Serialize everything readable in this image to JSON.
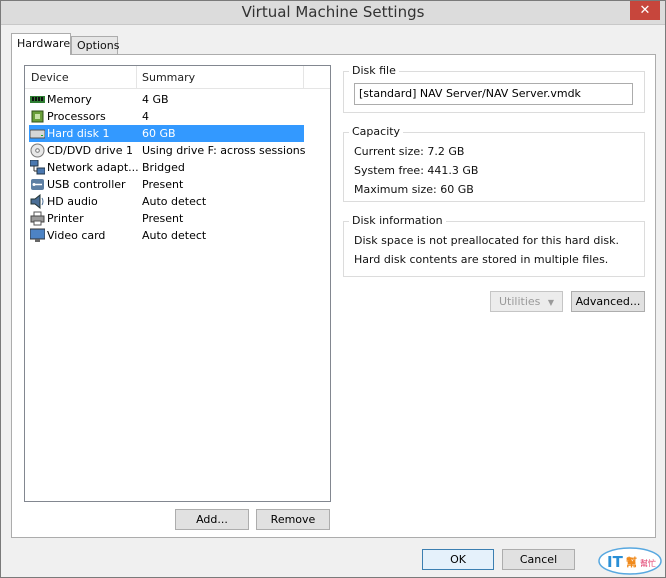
{
  "window": {
    "title": "Virtual Machine Settings",
    "close_glyph": "✕"
  },
  "tabs": [
    {
      "label": "Hardware",
      "active": true
    },
    {
      "label": "Options",
      "active": false
    }
  ],
  "device_list": {
    "columns": [
      "Device",
      "Summary"
    ],
    "rows": [
      {
        "name": "Memory",
        "summary": "4 GB",
        "icon": "memory-icon",
        "selected": false
      },
      {
        "name": "Processors",
        "summary": "4",
        "icon": "processor-icon",
        "selected": false
      },
      {
        "name": "Hard disk 1",
        "summary": "60 GB",
        "icon": "hard-disk-icon",
        "selected": true
      },
      {
        "name": "CD/DVD drive 1",
        "summary": "Using drive F: across sessions",
        "icon": "cd-dvd-icon",
        "selected": false
      },
      {
        "name": "Network adapt...",
        "summary": "Bridged",
        "icon": "network-icon",
        "selected": false
      },
      {
        "name": "USB controller",
        "summary": "Present",
        "icon": "usb-icon",
        "selected": false
      },
      {
        "name": "HD audio",
        "summary": "Auto detect",
        "icon": "speaker-icon",
        "selected": false
      },
      {
        "name": "Printer",
        "summary": "Present",
        "icon": "printer-icon",
        "selected": false
      },
      {
        "name": "Video card",
        "summary": "Auto detect",
        "icon": "monitor-icon",
        "selected": false
      }
    ]
  },
  "list_buttons": {
    "add": "Add...",
    "remove": "Remove"
  },
  "disk_file": {
    "title": "Disk file",
    "path": "[standard] NAV Server/NAV Server.vmdk"
  },
  "capacity": {
    "title": "Capacity",
    "current": "Current size: 7.2 GB",
    "free": "System free: 441.3 GB",
    "maximum": "Maximum size: 60 GB"
  },
  "disk_info": {
    "title": "Disk information",
    "line1": "Disk space is not preallocated for this hard disk.",
    "line2": "Hard disk contents are stored in multiple files."
  },
  "disk_buttons": {
    "utilities": "Utilities",
    "advanced": "Advanced..."
  },
  "dialog_buttons": {
    "ok": "OK",
    "cancel": "Cancel"
  },
  "colors": {
    "selection": "#3399ff",
    "accent": "#3c7fb1"
  }
}
